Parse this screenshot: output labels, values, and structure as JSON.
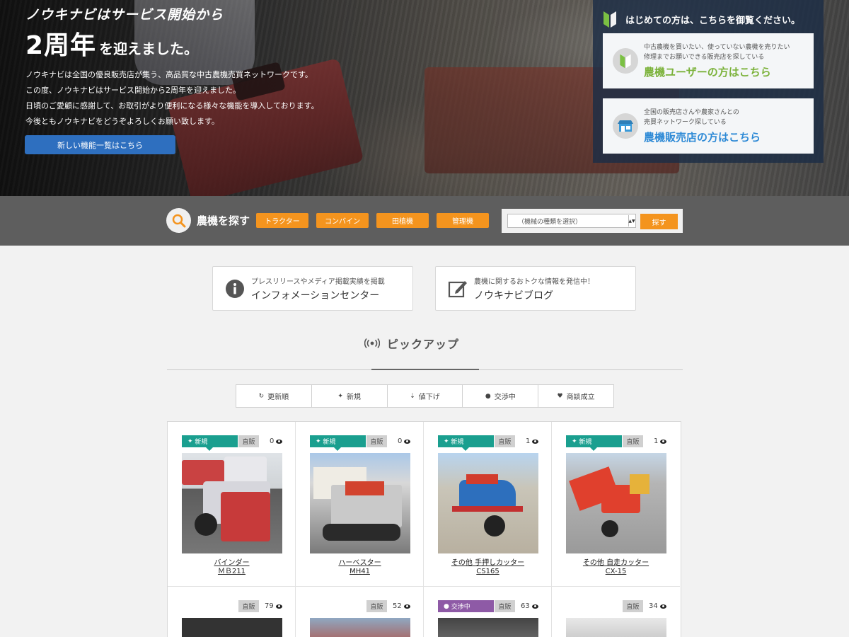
{
  "hero": {
    "sub": "ノウキナビはサービス開始から",
    "big": "2周年",
    "small": "を迎えました。",
    "desc": [
      "ノウキナビは全国の優良販売店が集う、高品質な中古農機売買ネットワークです。",
      "この度、ノウキナビはサービス開始から2周年を迎えました。",
      "日頃のご愛顧に感謝して、お取引がより便利になる様々な機能を導入しております。",
      "今後ともノウキナビをどうぞよろしくお願い致します。"
    ],
    "button": "新しい機能一覧はこちら"
  },
  "intro": {
    "title": "はじめての方は、こちらを御覧ください。",
    "user": {
      "line1": "中古農機を買いたい、使っていない農機を売りたい",
      "line2": "修理までお願いできる販売店を探している",
      "cta": "農機ユーザーの方はこちら"
    },
    "dealer": {
      "line1": "全国の販売店さんや農家さんとの",
      "line2": "売買ネットワーク探している",
      "cta": "農機販売店の方はこちら"
    }
  },
  "search": {
    "label": "農機を探す",
    "categories": [
      "トラクター",
      "コンバイン",
      "田植機",
      "管理機"
    ],
    "select_value": "（機械の種類を選択）",
    "go": "探す"
  },
  "info": {
    "press_small": "プレスリリースやメディア掲載実績を掲載",
    "press_large": "インフォメーションセンター",
    "blog_small": "農機に関するおトクな情報を発信中！",
    "blog_large": "ノウキナビブログ"
  },
  "pickup": {
    "title": "ピックアップ",
    "tabs": [
      "更新順",
      "新規",
      "値下げ",
      "交渉中",
      "商談成立"
    ]
  },
  "badges": {
    "new": "新規",
    "direct": "直販",
    "nego": "交渉中"
  },
  "items": [
    {
      "views": "0",
      "name": "バインダー",
      "model": "ＭＢ211"
    },
    {
      "views": "0",
      "name": "ハーベスター",
      "model": "MH41"
    },
    {
      "views": "1",
      "name": "その他 手押しカッター",
      "model": "CS165"
    },
    {
      "views": "1",
      "name": "その他 自走カッター",
      "model": "CX-15"
    },
    {
      "views": "79"
    },
    {
      "views": "52"
    },
    {
      "views": "63"
    },
    {
      "views": "34"
    }
  ],
  "colors": {
    "accent_orange": "#f4941e",
    "new_badge": "#1a9f8f",
    "nego_badge": "#8e5aa6",
    "user_cta": "#7bb23a",
    "dealer_cta": "#2e8ad6",
    "hero_button": "#2e6fbf"
  }
}
